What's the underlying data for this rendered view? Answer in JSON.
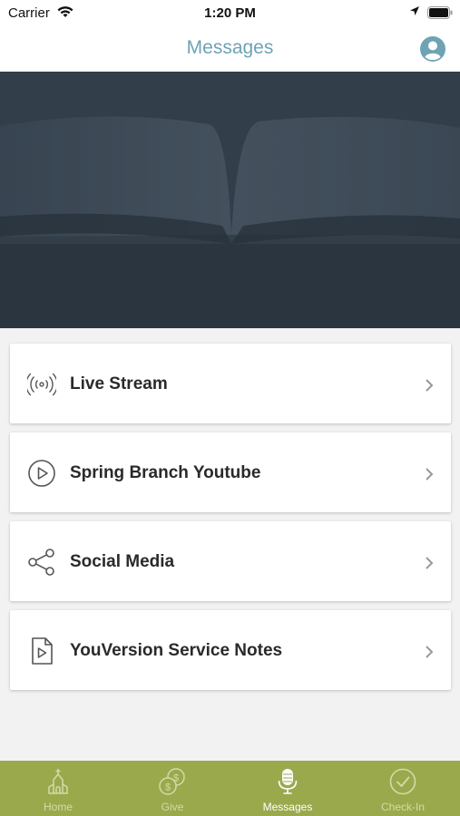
{
  "status": {
    "carrier": "Carrier",
    "time": "1:20 PM"
  },
  "header": {
    "title": "Messages"
  },
  "menu": [
    {
      "label": "Live Stream",
      "icon": "broadcast-icon"
    },
    {
      "label": "Spring Branch Youtube",
      "icon": "play-circle-icon"
    },
    {
      "label": "Social Media",
      "icon": "share-icon"
    },
    {
      "label": "YouVersion Service Notes",
      "icon": "document-play-icon"
    }
  ],
  "tabs": [
    {
      "label": "Home",
      "icon": "church-icon",
      "active": false
    },
    {
      "label": "Give",
      "icon": "coins-icon",
      "active": false
    },
    {
      "label": "Messages",
      "icon": "microphone-icon",
      "active": true
    },
    {
      "label": "Check-In",
      "icon": "check-circle-icon",
      "active": false
    }
  ],
  "colors": {
    "accent": "#6ea3b5",
    "tab_bar": "#9aa94c",
    "hero": "#3b4855"
  }
}
